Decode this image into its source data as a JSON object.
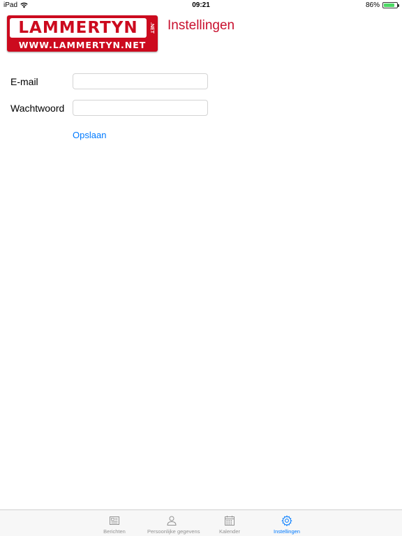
{
  "status_bar": {
    "device": "iPad",
    "time": "09:21",
    "battery": "86%",
    "battery_level": 0.86,
    "battery_color": "#4cd964"
  },
  "header": {
    "logo_word": "LAMMERTYN",
    "logo_net": ".NET",
    "logo_url": "WWW.LAMMERTYN.NET",
    "title": "Instellingen",
    "brand_color": "#cc0a1e"
  },
  "form": {
    "email_label": "E-mail",
    "email_value": "",
    "password_label": "Wachtwoord",
    "password_value": "",
    "save_label": "Opslaan"
  },
  "tabbar": {
    "active_color": "#007aff",
    "items": [
      {
        "label": "Berichten",
        "icon": "newspaper-icon",
        "active": false
      },
      {
        "label": "Persoonlijke gegevens",
        "icon": "person-icon",
        "active": false
      },
      {
        "label": "Kalender",
        "icon": "calendar-icon",
        "active": false
      },
      {
        "label": "Instellingen",
        "icon": "gear-icon",
        "active": true
      }
    ]
  }
}
